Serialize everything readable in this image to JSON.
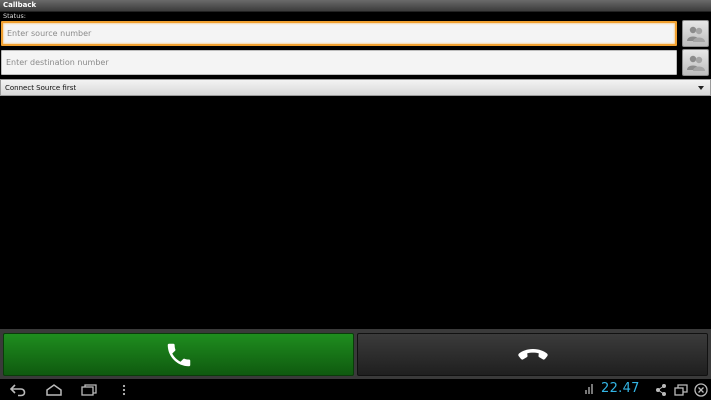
{
  "app": {
    "title": "Callback"
  },
  "status": {
    "label": "Status:"
  },
  "source": {
    "placeholder": "Enter source number",
    "value": ""
  },
  "destination": {
    "placeholder": "Enter destination number",
    "value": ""
  },
  "spinner": {
    "selected": "Connect Source first"
  },
  "icons": {
    "contacts": "contacts-icon",
    "call": "phone-call-icon",
    "hangup": "phone-hangup-icon",
    "back": "back-icon",
    "home": "home-icon",
    "recents": "recent-apps-icon",
    "menu": "menu-icon",
    "share": "share-icon",
    "window": "window-icon",
    "close": "close-icon"
  },
  "system_bar": {
    "clock": "22.47"
  },
  "colors": {
    "accent": "#f0a030",
    "call_green": "#1a7f1a",
    "clock_blue": "#33b5e5"
  }
}
